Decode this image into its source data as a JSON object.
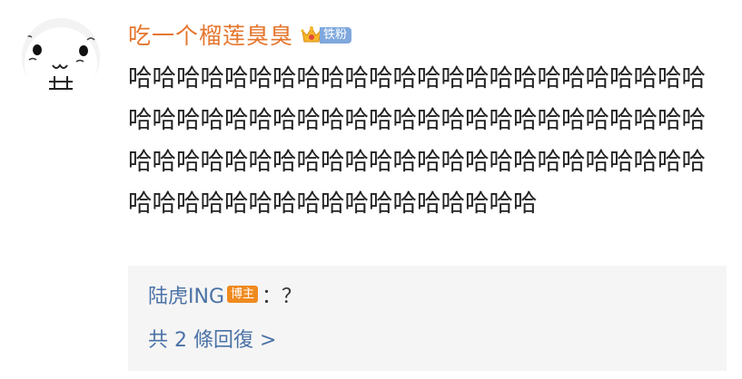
{
  "comment": {
    "username": "吃一个榴莲臭臭",
    "fan_badge": {
      "label": "铁粉",
      "icon": "crown-icon",
      "color": "#7fa8dd"
    },
    "text": "哈哈哈哈哈哈哈哈哈哈哈哈哈哈哈哈哈哈哈哈哈哈哈哈哈哈哈哈哈哈哈哈哈哈哈哈哈哈哈哈哈哈哈哈哈哈哈哈哈哈哈哈哈哈哈哈哈哈哈哈哈哈哈哈哈哈哈哈哈哈哈哈哈哈哈哈哈哈哈哈哈哈哈哈哈哈哈哈哈"
  },
  "reply": {
    "author": "陆虎ING",
    "host_badge": "博主",
    "content": "：？",
    "more_link": "共 2 條回復 >"
  },
  "colors": {
    "username": "#e5762e",
    "link_blue": "#4a72a6",
    "host_badge_bg": "#f08a1f",
    "reply_bg": "#f5f5f5"
  }
}
